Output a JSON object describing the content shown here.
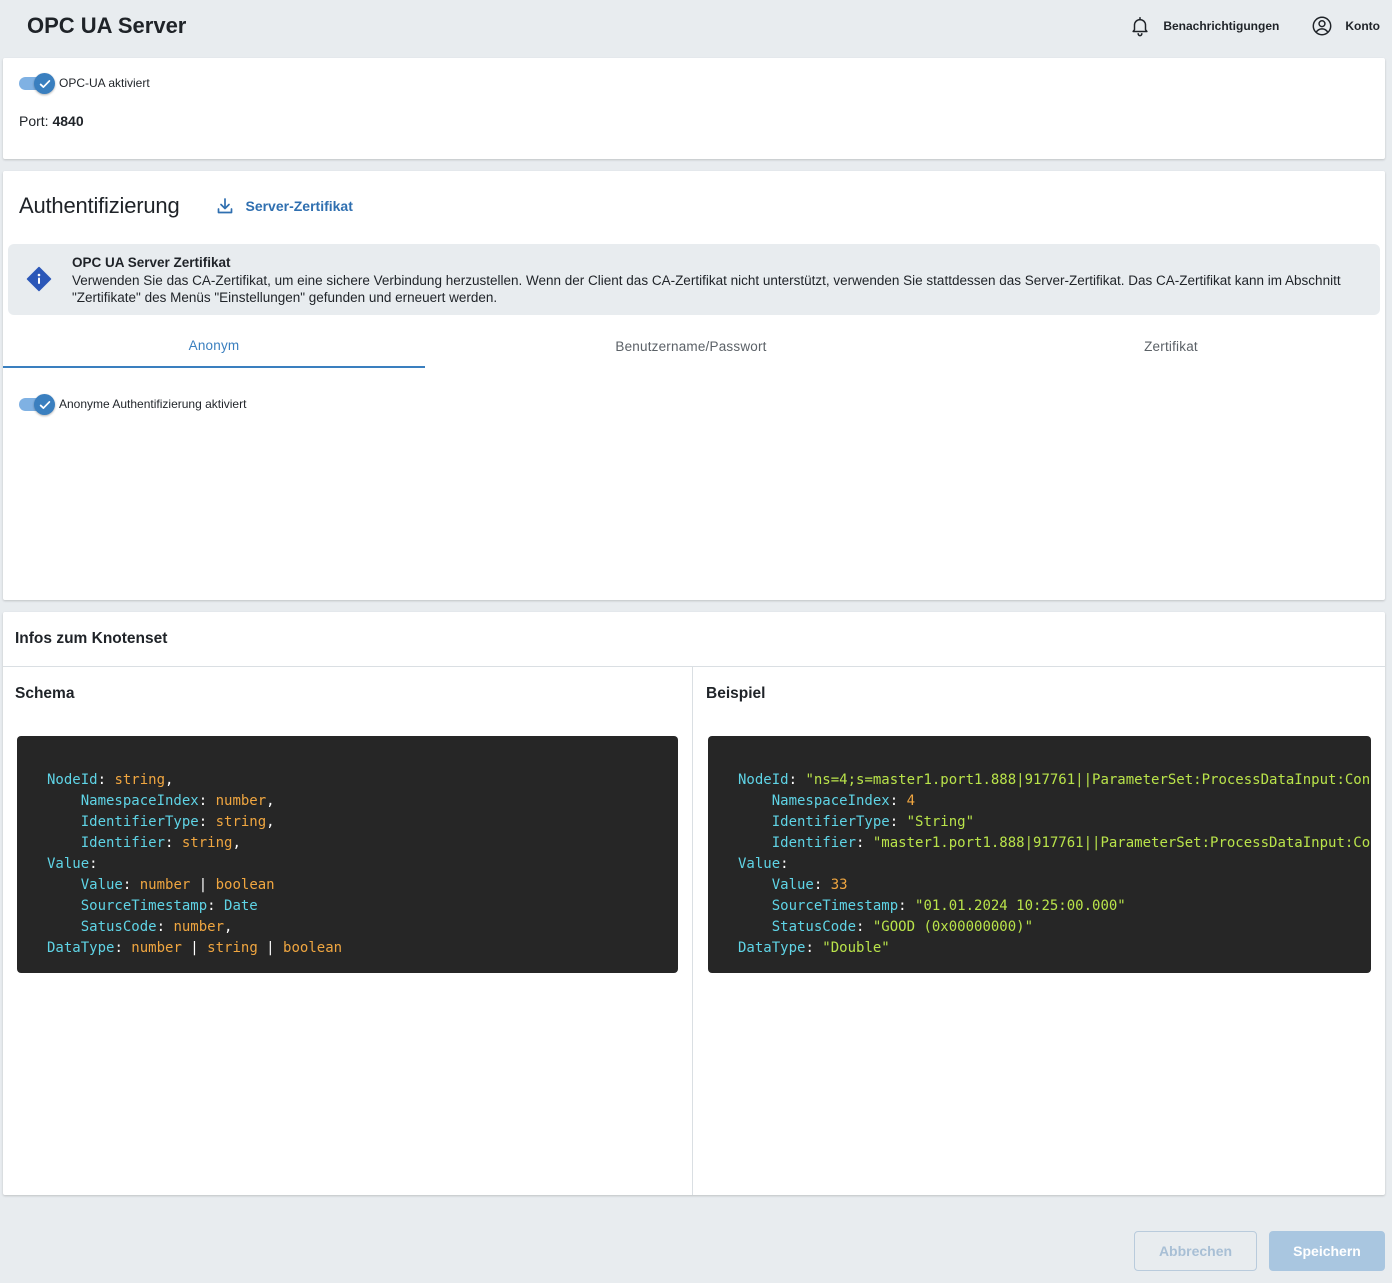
{
  "header": {
    "title": "OPC UA Server",
    "notifications_label": "Benachrichtigungen",
    "account_label": "Konto"
  },
  "opcua": {
    "toggle_label": "OPC-UA aktiviert",
    "toggle_on": true,
    "port_label": "Port:",
    "port_value": "4840"
  },
  "auth": {
    "title": "Authentifizierung",
    "server_cert_link": "Server-Zertifikat",
    "info": {
      "title": "OPC UA Server Zertifikat",
      "text": "Verwenden Sie das CA-Zertifikat, um eine sichere Verbindung herzustellen. Wenn der Client das CA-Zertifikat nicht unterstützt, verwenden Sie stattdessen das Server-Zertifikat. Das CA-Zertifikat kann im Abschnitt \"Zertifikate\" des Menüs \"Einstellungen\" gefunden und erneuert werden."
    },
    "tabs": [
      {
        "label": "Anonym",
        "active": true
      },
      {
        "label": "Benutzername/Passwort",
        "active": false
      },
      {
        "label": "Zertifikat",
        "active": false
      }
    ],
    "anonymous_toggle_label": "Anonyme Authentifizierung aktiviert",
    "anonymous_toggle_on": true
  },
  "nodeset": {
    "title": "Infos zum Knotenset",
    "schema_title": "Schema",
    "example_title": "Beispiel",
    "schema": {
      "nodeid_key": "NodeId",
      "nodeid_type": "string",
      "nsindex_key": "NamespaceIndex",
      "nsindex_type": "number",
      "idtype_key": "IdentifierType",
      "idtype_type": "string",
      "identifier_key": "Identifier",
      "identifier_type": "string",
      "value_key": "Value",
      "value_value_key": "Value",
      "value_value_type1": "number",
      "value_value_type2": "boolean",
      "source_key": "SourceTimestamp",
      "source_type": "Date",
      "status_key": "SatusCode",
      "status_type": "number",
      "datatype_key": "DataType",
      "datatype_type1": "number",
      "datatype_type2": "string",
      "datatype_type3": "boolean"
    },
    "example": {
      "nodeid_key": "NodeId",
      "nodeid_value": "\"ns=4;s=master1.port1.888|917761||ParameterSet:ProcessDataInput:Con",
      "nsindex_key": "NamespaceIndex",
      "nsindex_value": "4",
      "idtype_key": "IdentifierType",
      "idtype_value": "\"String\"",
      "identifier_key": "Identifier",
      "identifier_value": "\"master1.port1.888|917761||ParameterSet:ProcessDataInput:Co",
      "value_key": "Value",
      "value_value_key": "Value",
      "value_value": "33",
      "source_key": "SourceTimestamp",
      "source_value": "\"01.01.2024 10:25:00.000\"",
      "status_key": "StatusCode",
      "status_value": "\"GOOD (0x00000000)\"",
      "datatype_key": "DataType",
      "datatype_value": "\"Double\""
    }
  },
  "footer": {
    "cancel_label": "Abbrechen",
    "save_label": "Speichern"
  },
  "colors": {
    "accent": "#3a7fbf",
    "code_bg": "#262626",
    "code_key": "#5fd4e6",
    "code_type": "#f0a640",
    "code_string": "#b9e34a"
  },
  "icons": {
    "notifications": "bell-icon",
    "account": "account-circle-icon",
    "download": "download-icon",
    "info": "info-diamond-icon",
    "check": "check-icon"
  }
}
